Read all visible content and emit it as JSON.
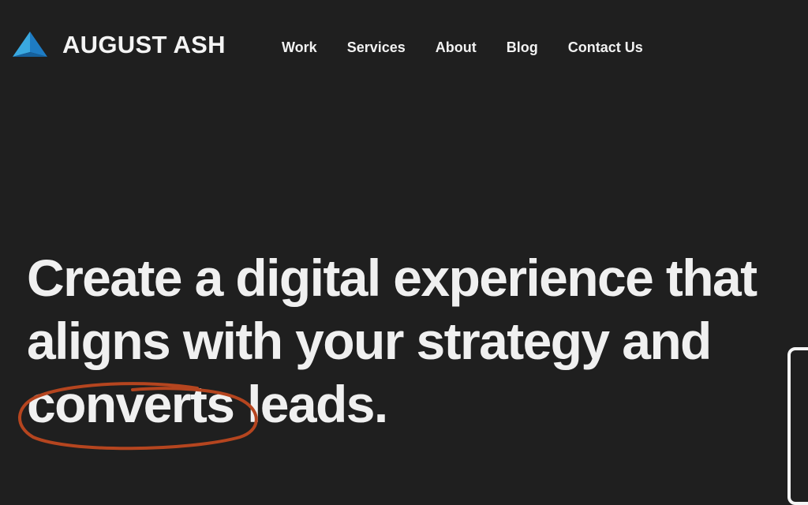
{
  "brand": {
    "name": "AUGUST ASH",
    "logo_icon": "triangle-logo-icon",
    "colors": {
      "background": "#1f1f1f",
      "logo_light": "#3aa9e0",
      "logo_dark": "#1b6fb3",
      "accent_circle": "#b5451f",
      "text": "#f2f2f2"
    }
  },
  "nav": {
    "items": [
      {
        "label": "Work"
      },
      {
        "label": "Services"
      },
      {
        "label": "About"
      },
      {
        "label": "Blog"
      },
      {
        "label": "Contact Us"
      }
    ]
  },
  "hero": {
    "line1": "Create a digital experience that",
    "line2": "aligns with your strategy and",
    "line3_highlight": "converts",
    "line3_rest": " leads."
  }
}
